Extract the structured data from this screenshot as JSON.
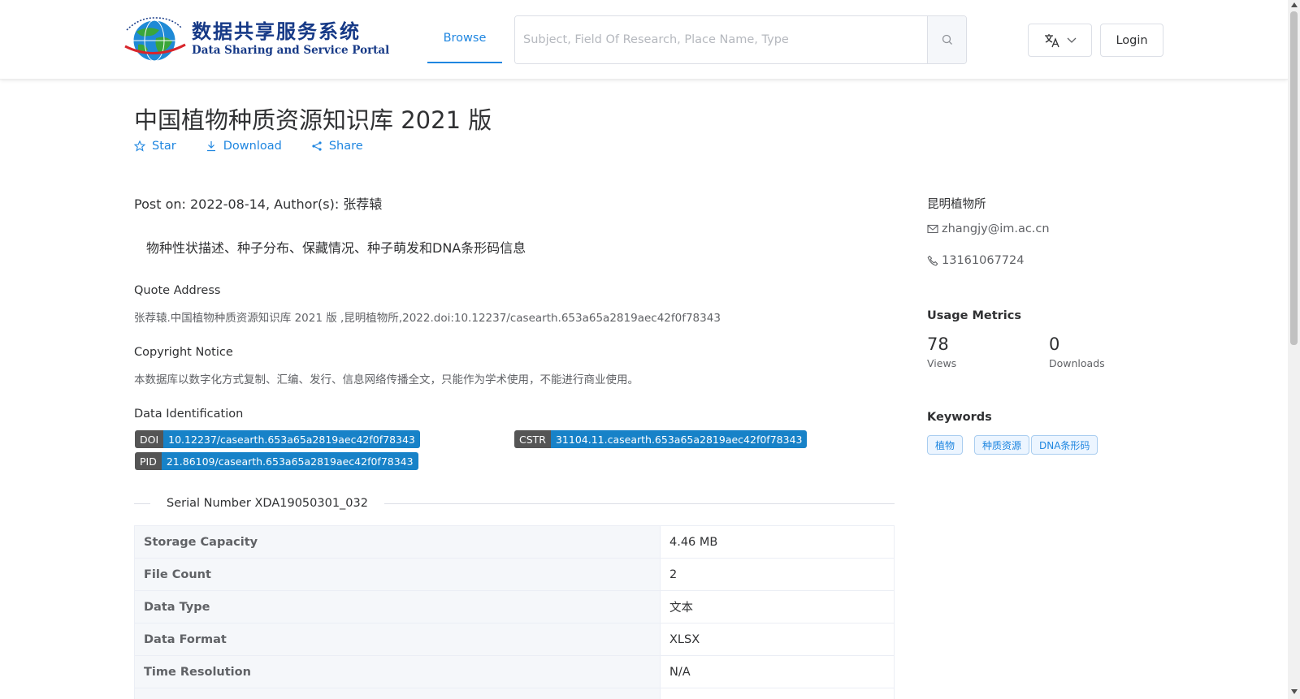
{
  "header": {
    "logo_cn": "数据共享服务系统",
    "logo_en": "Data Sharing and Service Portal",
    "nav_browse": "Browse",
    "search_placeholder": "Subject, Field Of Research, Place Name, Type",
    "login": "Login"
  },
  "dataset": {
    "title": "中国植物种质资源知识库 2021 版",
    "actions": {
      "star": "Star",
      "download": "Download",
      "share": "Share"
    },
    "post_on": "Post on: 2022-08-14, Author(s): 张荐辕",
    "description": "物种性状描述、种子分布、保藏情况、种子萌发和DNA条形码信息",
    "quote_label": "Quote Address",
    "quote_text": "张荐辕.中国植物种质资源知识库 2021 版 ,昆明植物所,2022.doi:10.12237/casearth.653a65a2819aec42f0f78343",
    "copyright_label": "Copyright Notice",
    "copyright_text": "本数据库以数字化方式复制、汇编、发行、信息网络传播全文，只能作为学术使用，不能进行商业使用。",
    "identification_label": "Data Identification",
    "ids": {
      "doi_key": "DOI",
      "doi_val": "10.12237/casearth.653a65a2819aec42f0f78343",
      "cstr_key": "CSTR",
      "cstr_val": "31104.11.casearth.653a65a2819aec42f0f78343",
      "pid_key": "PID",
      "pid_val": "21.86109/casearth.653a65a2819aec42f0f78343"
    },
    "serial_number": "Serial Number XDA19050301_032",
    "table": [
      {
        "key": "Storage Capacity",
        "value": "4.46 MB"
      },
      {
        "key": "File Count",
        "value": "2"
      },
      {
        "key": "Data Type",
        "value": "文本"
      },
      {
        "key": "Data Format",
        "value": "XLSX"
      },
      {
        "key": "Time Resolution",
        "value": "N/A"
      }
    ]
  },
  "sidebar": {
    "institution": "昆明植物所",
    "email": "zhangjy@im.ac.cn",
    "phone": "13161067724",
    "usage_title": "Usage Metrics",
    "views_num": "78",
    "views_label": "Views",
    "downloads_num": "0",
    "downloads_label": "Downloads",
    "keywords_title": "Keywords",
    "keywords": [
      "植物",
      "种质资源",
      "DNA条形码"
    ]
  },
  "colors": {
    "accent": "#1f86e0",
    "id_value_bg": "#1782c8",
    "id_key_bg": "#555555"
  }
}
